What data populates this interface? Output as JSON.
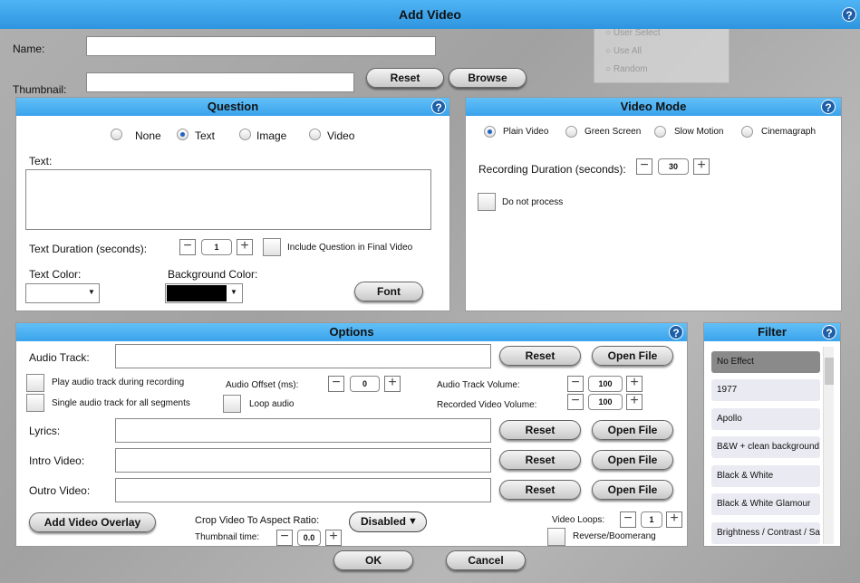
{
  "dialog": {
    "title": "Add Video"
  },
  "help_glyph": "?",
  "top": {
    "name_label": "Name:",
    "name_value": "",
    "thumbnail_label": "Thumbnail:",
    "thumbnail_value": "",
    "reset_label": "Reset",
    "browse_label": "Browse"
  },
  "background_options": [
    "User Select",
    "Use All",
    "Random"
  ],
  "question": {
    "title": "Question",
    "types": [
      "None",
      "Text",
      "Image",
      "Video"
    ],
    "selected": "Text",
    "text_label": "Text:",
    "text_value": "",
    "duration_label": "Text Duration (seconds):",
    "duration_value": "1",
    "include_label": "Include Question in Final Video",
    "text_color_label": "Text Color:",
    "text_color_value": "#ffffff",
    "bg_color_label": "Background Color:",
    "bg_color_value": "#000000",
    "font_label": "Font"
  },
  "video_mode": {
    "title": "Video Mode",
    "modes": [
      "Plain Video",
      "Green Screen",
      "Slow Motion",
      "Cinemagraph"
    ],
    "selected": "Plain Video",
    "recording_label": "Recording Duration (seconds):",
    "recording_value": "30",
    "do_not_process_label": "Do not process"
  },
  "options": {
    "title": "Options",
    "audio_track_label": "Audio Track:",
    "play_during_label": "Play audio track during recording",
    "single_audio_label": "Single audio track for all segments",
    "audio_offset_label": "Audio Offset (ms):",
    "audio_offset_value": "0",
    "loop_audio_label": "Loop audio",
    "audio_volume_label": "Audio Track Volume:",
    "audio_volume_value": "100",
    "recorded_volume_label": "Recorded Video Volume:",
    "recorded_volume_value": "100",
    "lyrics_label": "Lyrics:",
    "intro_label": "Intro Video:",
    "outro_label": "Outro Video:",
    "reset_label": "Reset",
    "open_file_label": "Open File",
    "overlay_label": "Add Video Overlay",
    "crop_label": "Crop Video To Aspect Ratio:",
    "crop_value": "Disabled",
    "thumbnail_time_label": "Thumbnail time:",
    "thumbnail_time_value": "0.0",
    "loops_label": "Video Loops:",
    "loops_value": "1",
    "reverse_label": "Reverse/Boomerang"
  },
  "filter": {
    "title": "Filter",
    "items": [
      "No Effect",
      "1977",
      "Apollo",
      "B&W + clean background",
      "Black & White",
      "Black & White Glamour",
      "Brightness / Contrast / Sa"
    ],
    "selected": "No Effect"
  },
  "footer": {
    "ok_label": "OK",
    "cancel_label": "Cancel"
  }
}
